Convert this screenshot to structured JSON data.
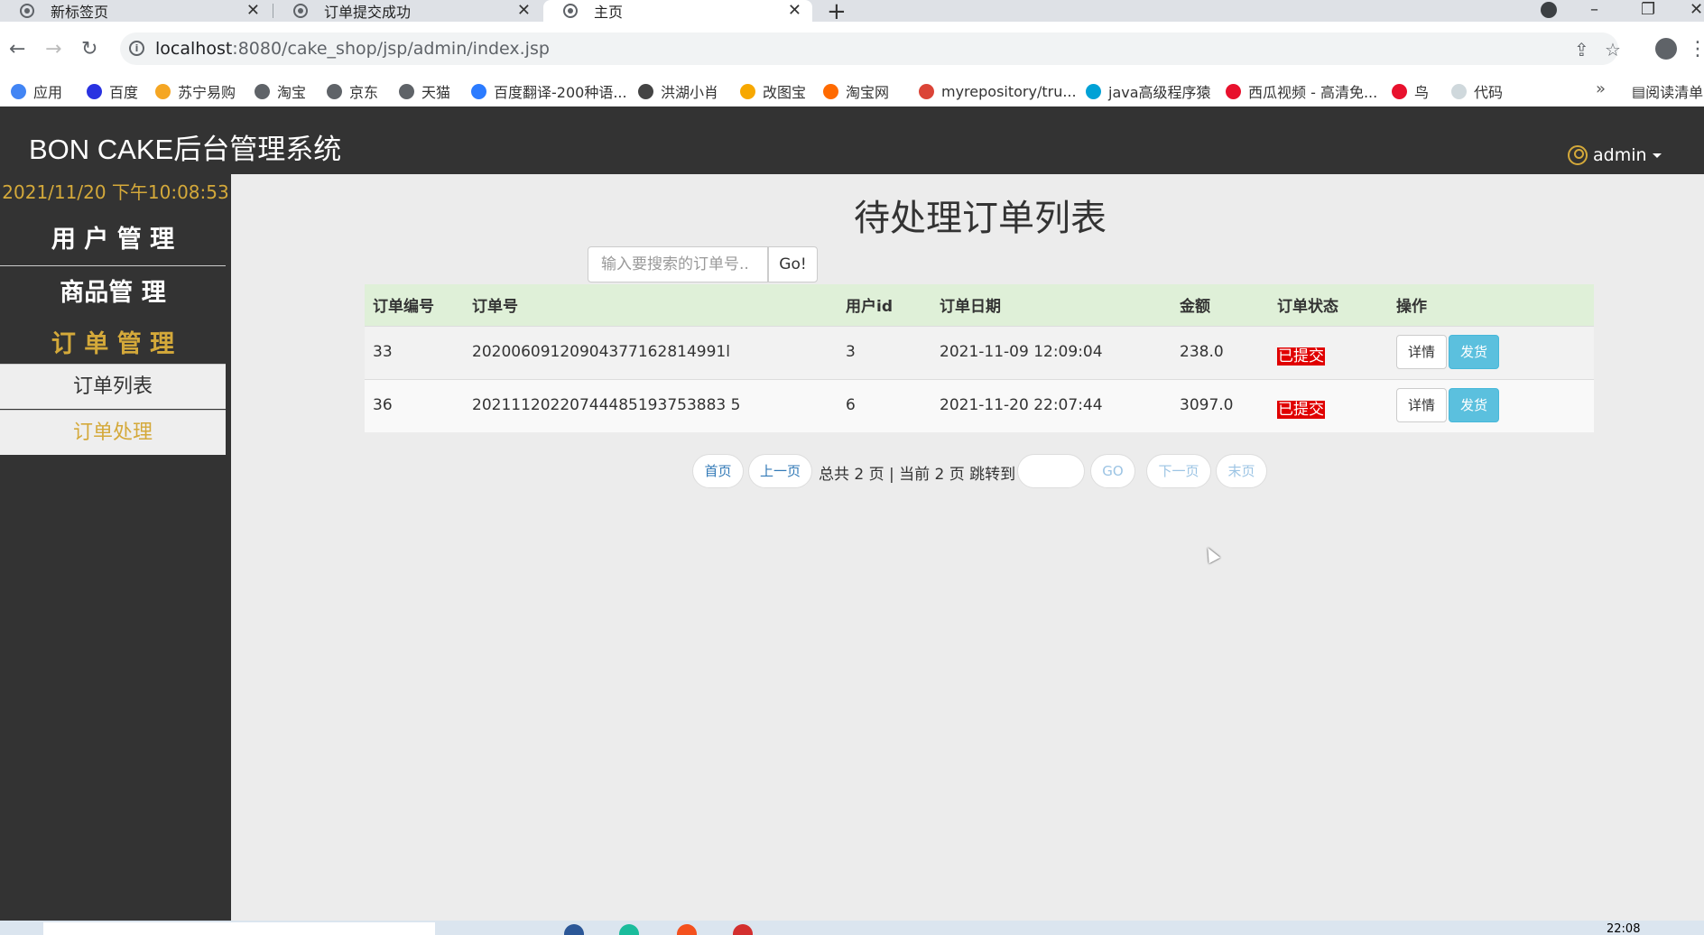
{
  "browser": {
    "tabs": [
      {
        "title": "新标签页",
        "active": false
      },
      {
        "title": "订单提交成功",
        "active": false
      },
      {
        "title": "主页",
        "active": true
      }
    ],
    "url_host": "localhost",
    "url_rest": ":8080/cake_shop/jsp/admin/index.jsp",
    "bookmarks": [
      {
        "label": "应用",
        "icon": "apps-grid-icon",
        "color": "#4285f4"
      },
      {
        "label": "百度",
        "icon": "baidu-paw-icon",
        "color": "#2932e1"
      },
      {
        "label": "苏宁易购",
        "icon": "suning-icon",
        "color": "#f5a623"
      },
      {
        "label": "淘宝",
        "icon": "globe-icon",
        "color": "#5f6368"
      },
      {
        "label": "京东",
        "icon": "globe-icon",
        "color": "#5f6368"
      },
      {
        "label": "天猫",
        "icon": "globe-icon",
        "color": "#5f6368"
      },
      {
        "label": "百度翻译-200种语...",
        "icon": "baidu-translate-icon",
        "color": "#2b7bff"
      },
      {
        "label": "洪湖小肖",
        "icon": "bird-icon",
        "color": "#444444"
      },
      {
        "label": "改图宝",
        "icon": "gaitubao-icon",
        "color": "#f7a800"
      },
      {
        "label": "淘宝网",
        "icon": "taobao-icon",
        "color": "#ff6a00"
      },
      {
        "label": "myrepository/tru...",
        "icon": "chrome-icon",
        "color": "#db4437"
      },
      {
        "label": "java高级程序猿",
        "icon": "bilibili-icon",
        "color": "#00a1d6"
      },
      {
        "label": "西瓜视频 - 高清免...",
        "icon": "xigua-icon",
        "color": "#e8112d"
      },
      {
        "label": "鸟",
        "icon": "bird-red-icon",
        "color": "#e8112d"
      },
      {
        "label": "代码",
        "icon": "code-icon",
        "color": "#cfd8dc"
      }
    ],
    "more_label": "»",
    "reading_list": "阅读清单"
  },
  "app": {
    "brand": "BON CAKE后台管理系统",
    "user": "admin",
    "accent": "#d4a93a",
    "clock": "2021/11/20 下午10:08:53",
    "menu": {
      "users": "用 户 管 理",
      "products": "商品管 理",
      "orders": "订 单 管 理",
      "order_list": "订单列表",
      "order_process": "订单处理"
    }
  },
  "main": {
    "title": "待处理订单列表",
    "search_placeholder": "输入要搜索的订单号..",
    "search_button": "Go!",
    "table": {
      "headers": [
        "订单编号",
        "订单号",
        "用户id",
        "订单日期",
        "金额",
        "订单状态",
        "操作"
      ],
      "rows": [
        {
          "no": "33",
          "order_id": "20200609120904377162814991l",
          "user_id": "3",
          "date": "2021-11-09 12:09:04",
          "amount": "238.0",
          "status": "已提交"
        },
        {
          "no": "36",
          "order_id": "20211120220744485193753883 5",
          "user_id": "6",
          "date": "2021-11-20 22:07:44",
          "amount": "3097.0",
          "status": "已提交"
        }
      ],
      "detail_label": "详情",
      "ship_label": "发货"
    },
    "pager": {
      "first": "首页",
      "prev": "上一页",
      "info": "总共 2 页 | 当前 2 页 跳转到",
      "go": "GO",
      "next": "下一页",
      "last": "末页"
    }
  },
  "taskbar": {
    "time": "22:08"
  }
}
